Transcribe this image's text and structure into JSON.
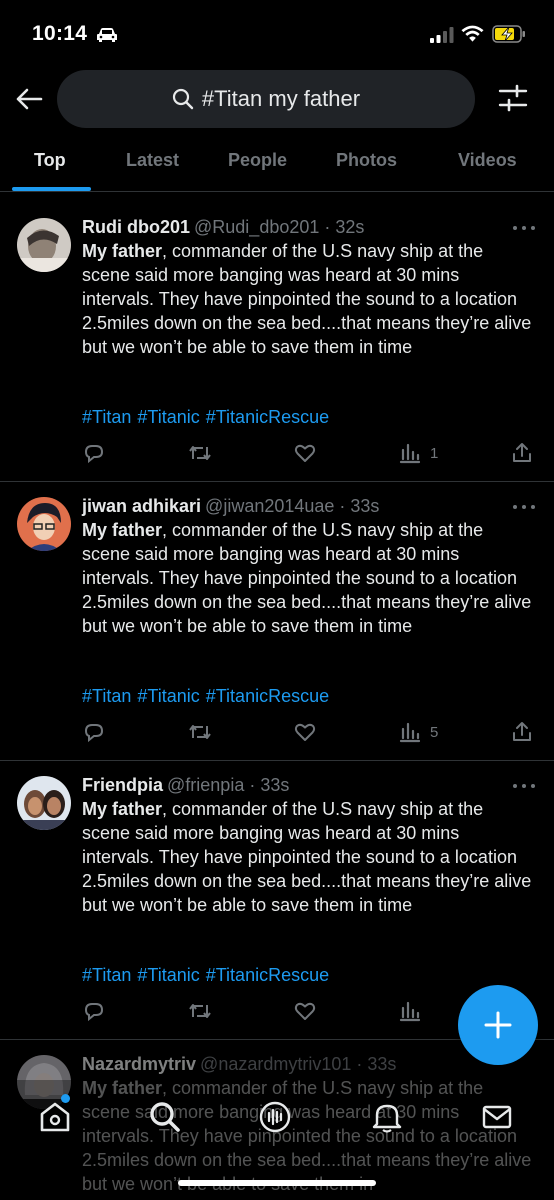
{
  "status_bar": {
    "time": "10:14",
    "icons": [
      "car-icon",
      "signal-icon",
      "wifi-icon",
      "battery-charging-icon"
    ]
  },
  "search": {
    "query": "#Titan my father",
    "icons": [
      "back-arrow-icon",
      "search-icon",
      "filter-icon"
    ]
  },
  "tabs": [
    {
      "label": "Top",
      "active": true
    },
    {
      "label": "Latest",
      "active": false
    },
    {
      "label": "People",
      "active": false
    },
    {
      "label": "Photos",
      "active": false
    },
    {
      "label": "Videos",
      "active": false
    }
  ],
  "tweets": [
    {
      "name": "Rudi dbo201",
      "handle": "@Rudi_dbo201 · 32s",
      "body_bold": "My father",
      "body_rest": ", commander of the U.S navy ship at the scene said more banging was heard at 30 mins intervals. They have pinpointed the sound to a location 2.5miles down on the sea bed....that means they’re alive but we won’t be able to save them in time",
      "hashtags": "#Titan #Titanic #TitanicRescue",
      "views": "1"
    },
    {
      "name": "jiwan adhikari",
      "handle": "@jiwan2014uae · 33s",
      "body_bold": "My father",
      "body_rest": ", commander of the U.S navy ship at the scene said more banging was heard at 30 mins intervals. They have pinpointed the sound to a location 2.5miles down on the sea bed....that means they’re alive but we won’t be able to save them in time",
      "hashtags": "#Titan #Titanic #TitanicRescue",
      "views": "5"
    },
    {
      "name": "Friendpia",
      "handle": "@frienpia · 33s",
      "body_bold": "My father",
      "body_rest": ", commander of the U.S navy ship at the scene said more banging was heard at 30 mins intervals. They have pinpointed the sound to a location 2.5miles down on the sea bed....that means they’re alive but we won’t be able to save them in time",
      "hashtags": "#Titan #Titanic #TitanicRescue",
      "views": ""
    },
    {
      "name": "Nazardmytriv",
      "handle": "@nazardmytriv101 · 33s",
      "body_bold": "My father",
      "body_rest": ", commander of the U.S navy ship at the scene said more banging was heard at 30 mins intervals. They have pinpointed the sound to a location 2.5miles down on the sea bed....that means they’re alive but we won’t be able to save them in",
      "hashtags": "",
      "views": ""
    }
  ],
  "fab": {
    "icon": "plus-icon"
  },
  "bottom_nav": [
    "home-icon",
    "search-icon",
    "spaces-icon",
    "notifications-icon",
    "messages-icon"
  ],
  "colors": {
    "accent": "#1d9bf0",
    "background": "#000000",
    "muted": "#71767b"
  }
}
